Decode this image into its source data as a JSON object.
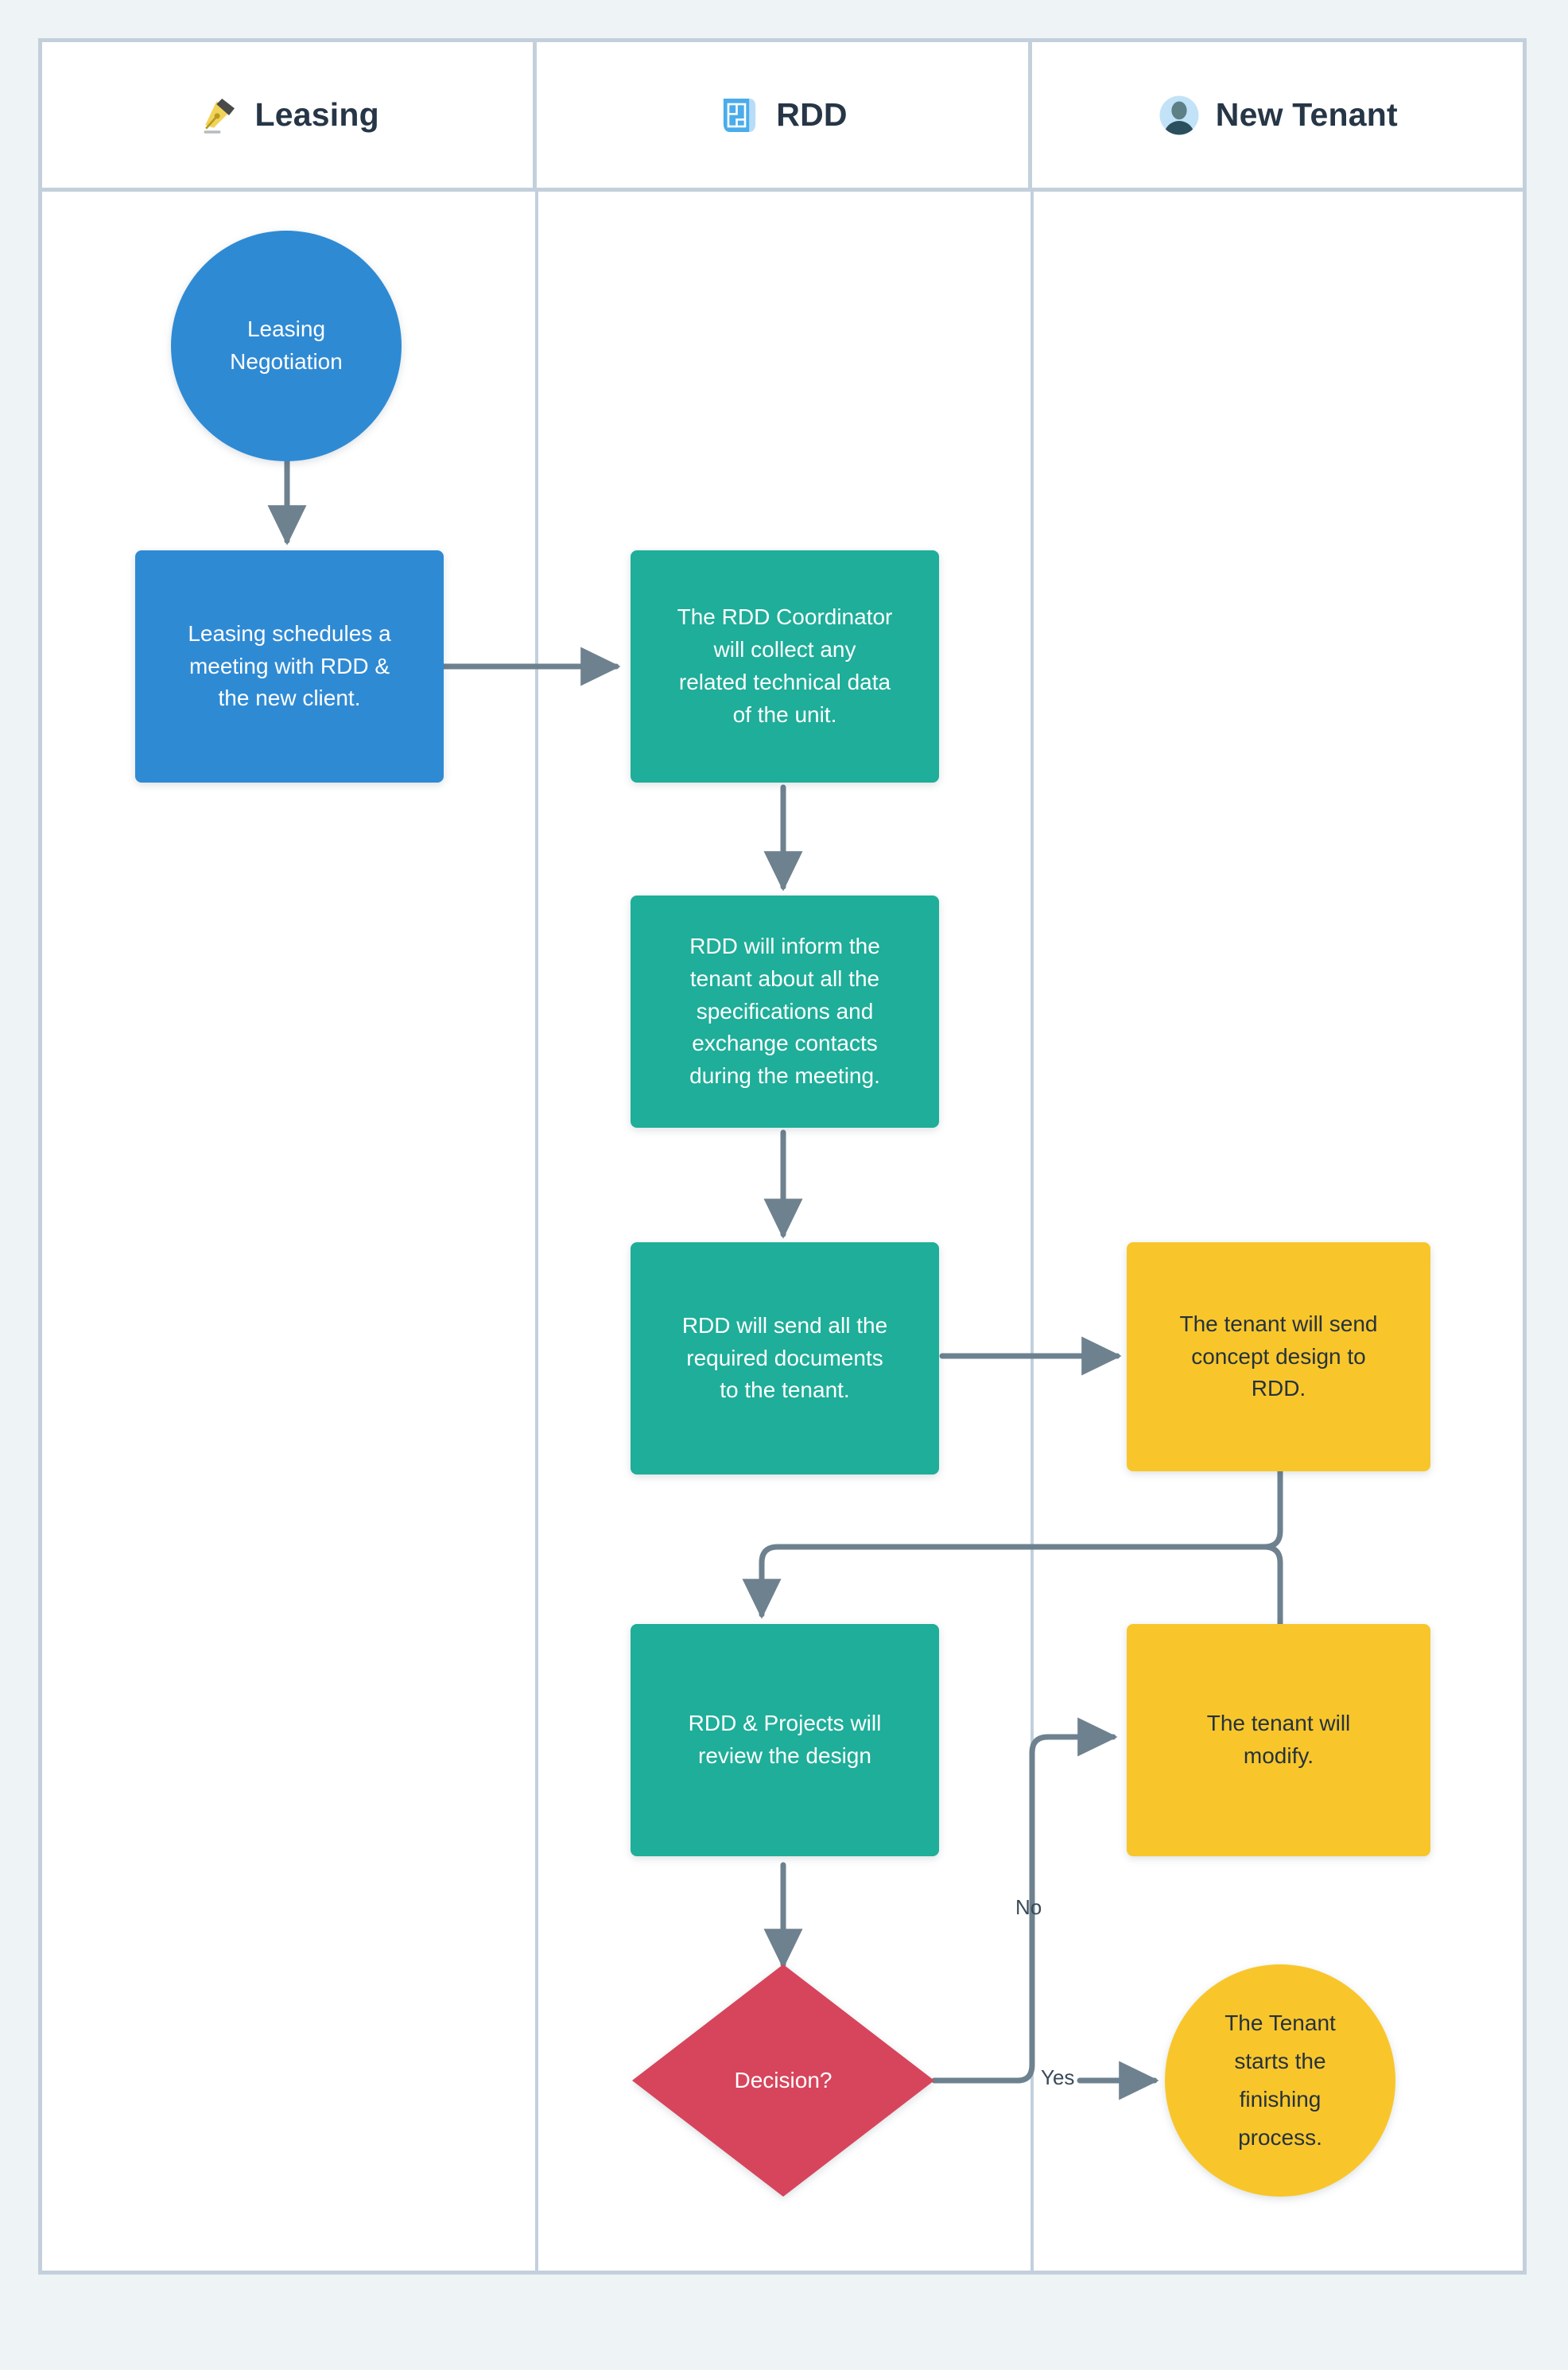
{
  "diagram": {
    "type": "swimlane-flowchart",
    "background_color": "#eef3f6",
    "frame_border_color": "#c3d0dc",
    "connector_color": "#6e818f",
    "palette": {
      "blue": "#2f8ad4",
      "teal": "#1eae99",
      "yellow": "#f8c62b",
      "red": "#d6455c",
      "dark_text": "#26323c"
    },
    "lanes": [
      {
        "id": "leasing",
        "label": "Leasing",
        "icon": "fountain-pen-nib-icon"
      },
      {
        "id": "rdd",
        "label": "RDD",
        "icon": "blueprint-icon"
      },
      {
        "id": "new_tenant",
        "label": "New Tenant",
        "icon": "person-avatar-icon"
      }
    ],
    "nodes": [
      {
        "id": "n1",
        "lane": "leasing",
        "shape": "circle",
        "color": "blue",
        "text": "Leasing\nNegotiation"
      },
      {
        "id": "n2",
        "lane": "leasing",
        "shape": "rect",
        "color": "blue",
        "text": "Leasing schedules a\nmeeting with RDD &\nthe new client."
      },
      {
        "id": "n3",
        "lane": "rdd",
        "shape": "rect",
        "color": "teal",
        "text": "The RDD Coordinator\nwill collect any\nrelated technical data\nof the unit."
      },
      {
        "id": "n4",
        "lane": "rdd",
        "shape": "rect",
        "color": "teal",
        "text": "RDD will inform the\ntenant about all the\nspecifications and\nexchange contacts\nduring the meeting."
      },
      {
        "id": "n5",
        "lane": "rdd",
        "shape": "rect",
        "color": "teal",
        "text": "RDD will send all the\nrequired documents\nto the tenant."
      },
      {
        "id": "n6",
        "lane": "new_tenant",
        "shape": "rect",
        "color": "yellow",
        "text": "The tenant will send\nconcept design to\nRDD."
      },
      {
        "id": "n7",
        "lane": "rdd",
        "shape": "rect",
        "color": "teal",
        "text": "RDD & Projects will\nreview the design"
      },
      {
        "id": "n8",
        "lane": "new_tenant",
        "shape": "rect",
        "color": "yellow",
        "text": "The tenant will\nmodify."
      },
      {
        "id": "n9",
        "lane": "rdd",
        "shape": "diamond",
        "color": "red",
        "text": "Decision?"
      },
      {
        "id": "n10",
        "lane": "new_tenant",
        "shape": "ellipse",
        "color": "yellow",
        "text": "The Tenant\nstarts the\nfinishing\nprocess."
      }
    ],
    "edges": [
      {
        "from": "n1",
        "to": "n2",
        "label": ""
      },
      {
        "from": "n2",
        "to": "n3",
        "label": ""
      },
      {
        "from": "n3",
        "to": "n4",
        "label": ""
      },
      {
        "from": "n4",
        "to": "n5",
        "label": ""
      },
      {
        "from": "n5",
        "to": "n6",
        "label": ""
      },
      {
        "from": "n6",
        "to": "n7",
        "label": ""
      },
      {
        "from": "n7",
        "to": "n9",
        "label": ""
      },
      {
        "from": "n9",
        "to": "n8",
        "label": "No"
      },
      {
        "from": "n9",
        "to": "n10",
        "label": "Yes"
      },
      {
        "from": "n8",
        "to": "n7",
        "label": ""
      }
    ],
    "edge_labels": {
      "no": "No",
      "yes": "Yes"
    }
  }
}
